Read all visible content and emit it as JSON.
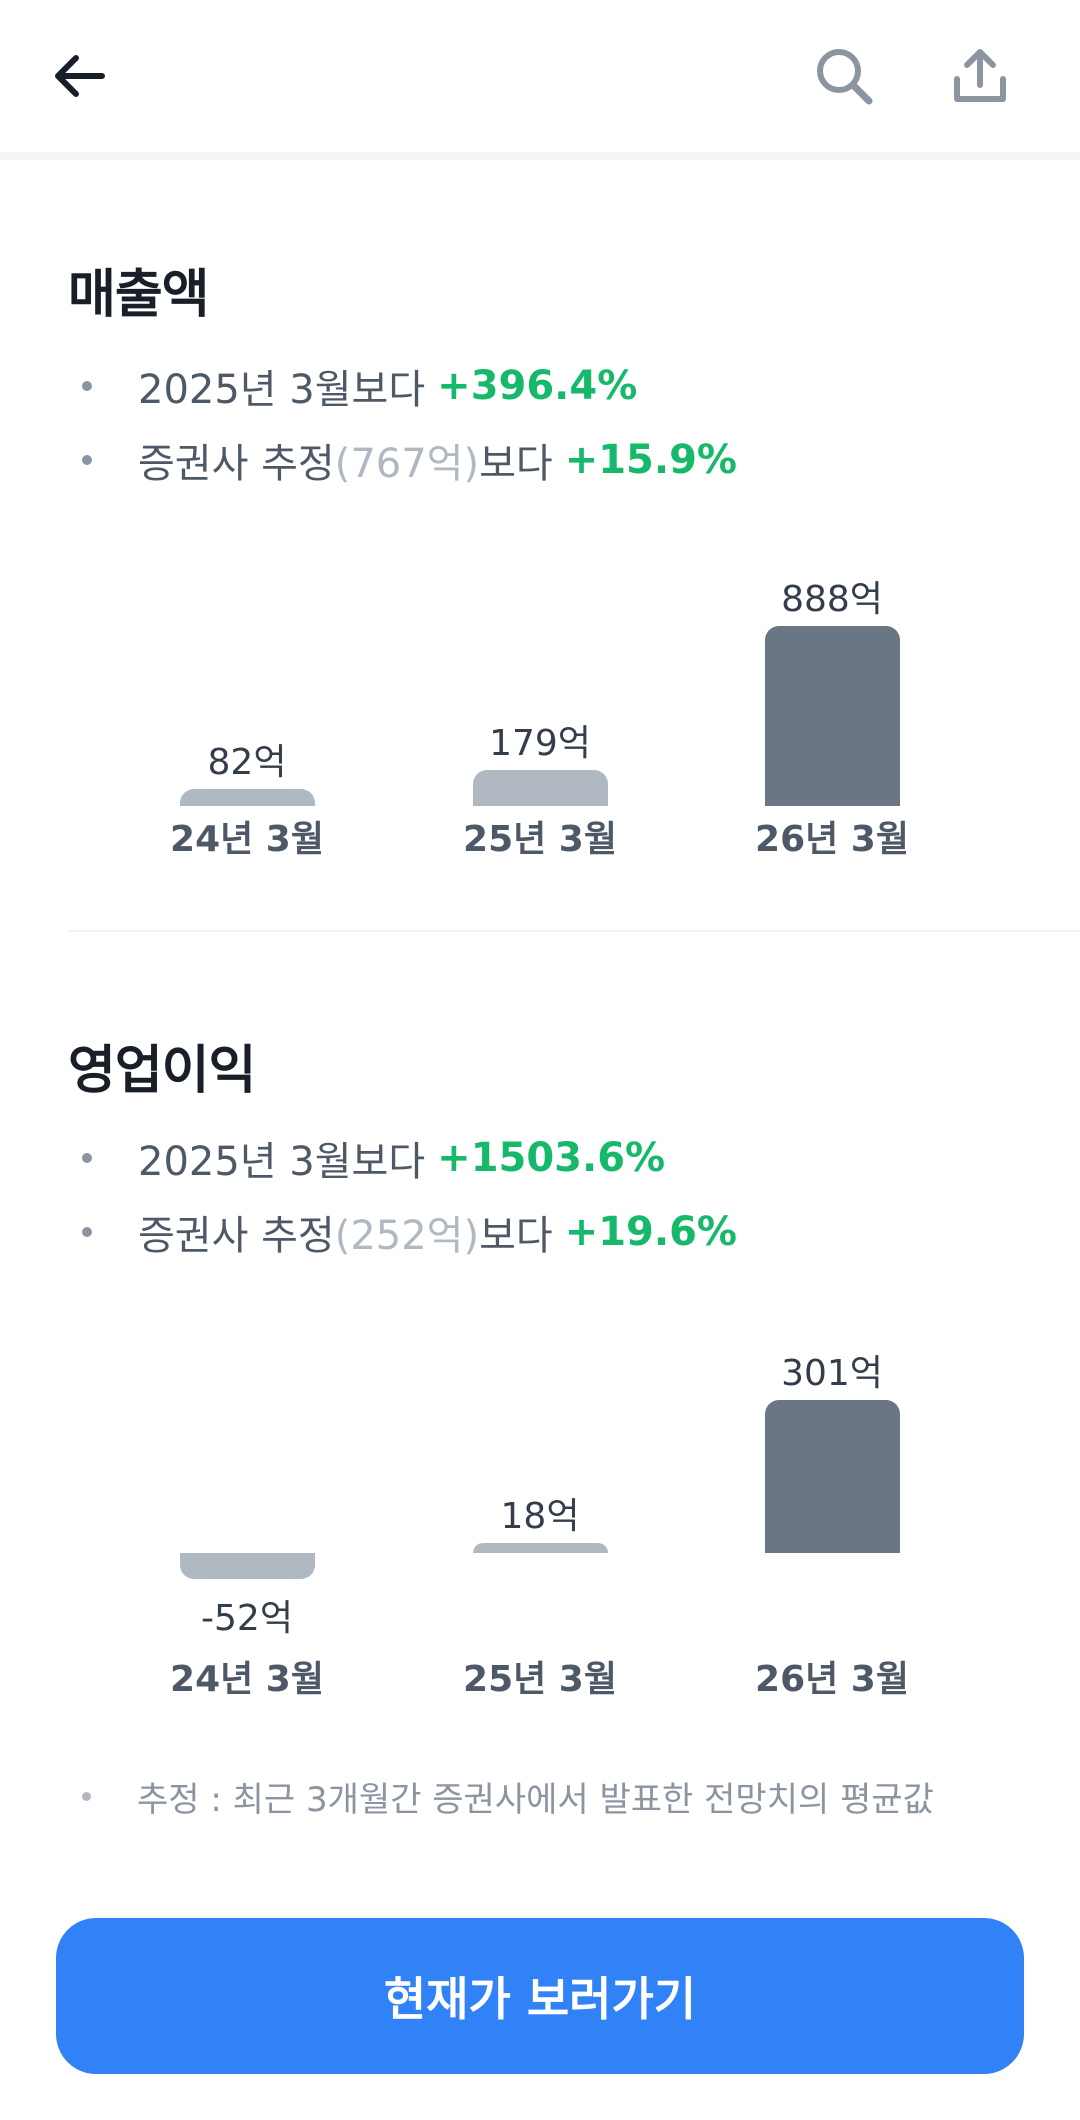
{
  "header": {
    "back_icon": "back-arrow-icon",
    "search_icon": "search-icon",
    "share_icon": "share-icon"
  },
  "sections": [
    {
      "title": "매출액",
      "compare_prefix": "2025년 3월보다",
      "compare_value": "+396.4%",
      "estimate_prefix": "증권사 추정",
      "estimate_amount": "(767억)",
      "estimate_suffix": "보다",
      "estimate_value": "+15.9%"
    },
    {
      "title": "영업이익",
      "compare_prefix": "2025년 3월보다",
      "compare_value": "+1503.6%",
      "estimate_prefix": "증권사 추정",
      "estimate_amount": "(252억)",
      "estimate_suffix": "보다",
      "estimate_value": "+19.6%"
    }
  ],
  "chart_data": [
    {
      "type": "bar",
      "categories": [
        "24년 3월",
        "25년 3월",
        "26년 3월"
      ],
      "values": [
        82,
        179,
        888
      ],
      "value_labels": [
        "82억",
        "179억",
        "888억"
      ],
      "unit": "억"
    },
    {
      "type": "bar",
      "categories": [
        "24년 3월",
        "25년 3월",
        "26년 3월"
      ],
      "values": [
        -52,
        18,
        301
      ],
      "value_labels": [
        "-52억",
        "18억",
        "301억"
      ],
      "unit": "억"
    }
  ],
  "footnote": "추정 : 최근 3개월간 증권사에서 발표한 전망치의 평균값",
  "cta_label": "현재가 보러가기",
  "colors": {
    "accent": "#3182f6",
    "positive": "#16b869",
    "bar_past": "#b0b8c1",
    "bar_current": "#6b7684"
  }
}
